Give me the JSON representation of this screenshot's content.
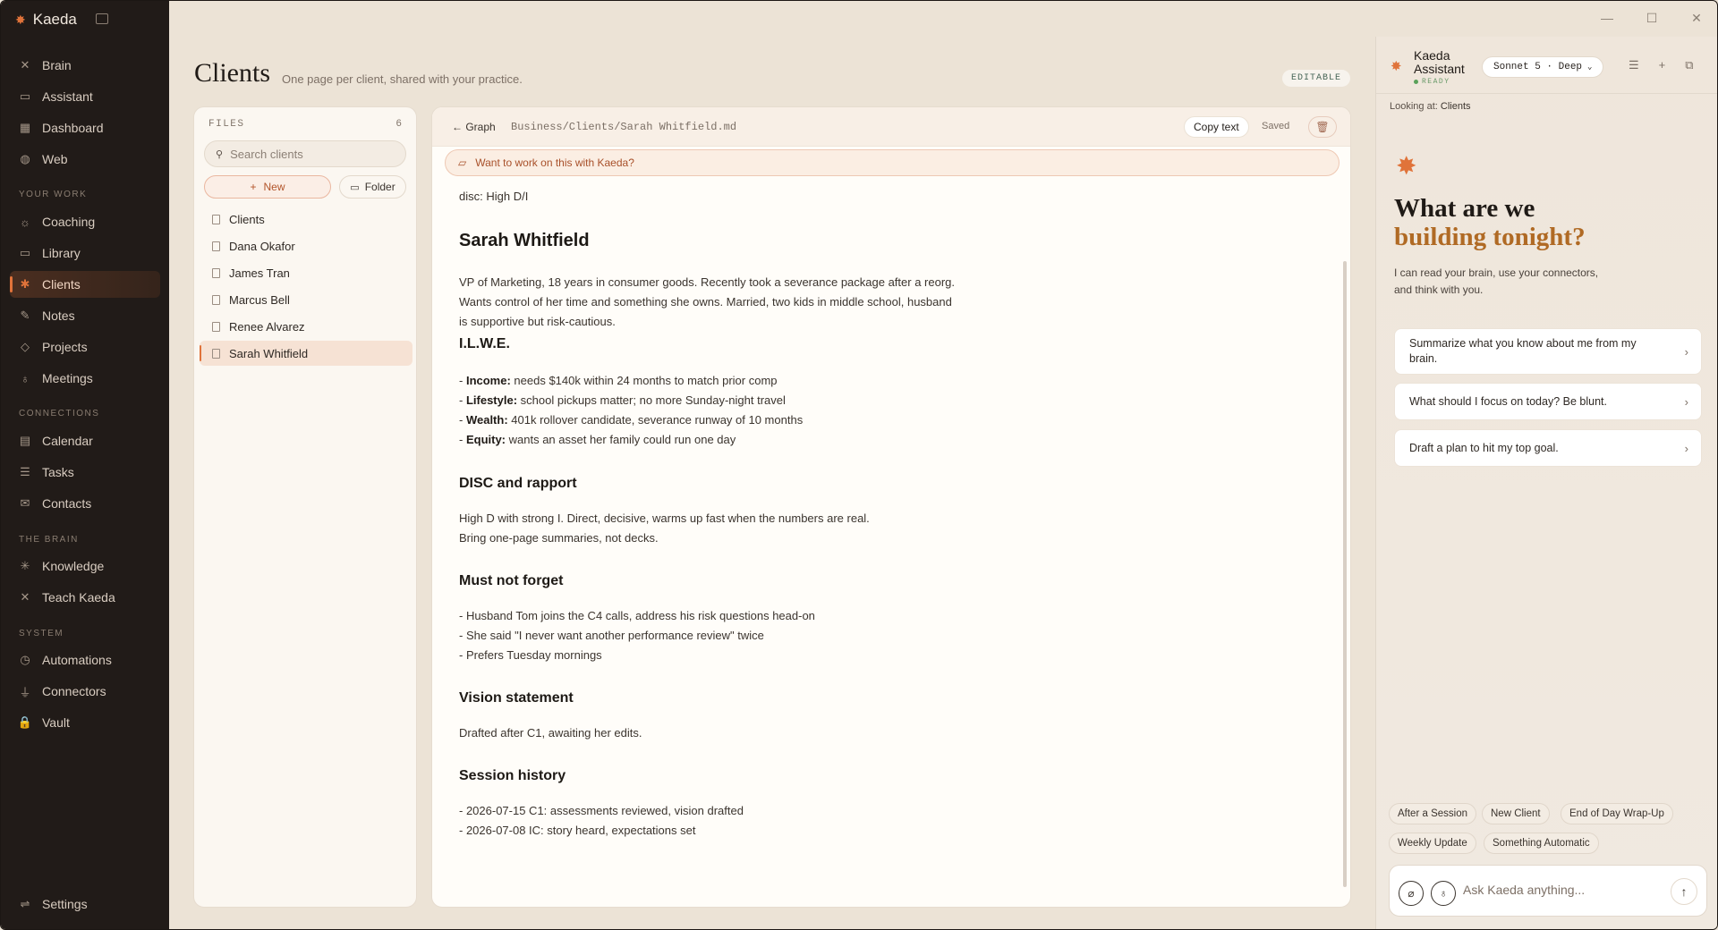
{
  "app": {
    "name": "Kaeda"
  },
  "sidebar": {
    "top_items": [
      {
        "label": "Brain",
        "icon": "✕"
      },
      {
        "label": "Assistant",
        "icon": "▭"
      },
      {
        "label": "Dashboard",
        "icon": "▦"
      },
      {
        "label": "Web",
        "icon": "◍"
      }
    ],
    "section_work": "YOUR WORK",
    "work_items": [
      {
        "label": "Coaching",
        "icon": "☼"
      },
      {
        "label": "Library",
        "icon": "▭"
      },
      {
        "label": "Clients",
        "icon": "✱"
      },
      {
        "label": "Notes",
        "icon": "✎"
      },
      {
        "label": "Projects",
        "icon": "◇"
      },
      {
        "label": "Meetings",
        "icon": "♁"
      }
    ],
    "section_connections": "CONNECTIONS",
    "connection_items": [
      {
        "label": "Calendar",
        "icon": "▤"
      },
      {
        "label": "Tasks",
        "icon": "☰"
      },
      {
        "label": "Contacts",
        "icon": "✉"
      }
    ],
    "section_brain": "THE BRAIN",
    "brain_items": [
      {
        "label": "Knowledge",
        "icon": "✳"
      },
      {
        "label": "Teach Kaeda",
        "icon": "✕"
      }
    ],
    "section_system": "SYSTEM",
    "system_items": [
      {
        "label": "Automations",
        "icon": "◷"
      },
      {
        "label": "Connectors",
        "icon": "⏚"
      },
      {
        "label": "Vault",
        "icon": "🔒"
      }
    ],
    "settings": {
      "label": "Settings",
      "icon": "⇌"
    }
  },
  "header": {
    "title": "Clients",
    "subtitle": "One page per client, shared with your practice.",
    "badge": "EDITABLE"
  },
  "files": {
    "header": "FILES",
    "count": "6",
    "search_placeholder": "Search clients",
    "new_label": "New",
    "folder_label": "Folder",
    "items": [
      "Clients",
      "Dana Okafor",
      "James Tran",
      "Marcus Bell",
      "Renee Alvarez",
      "Sarah Whitfield"
    ],
    "selected": "Sarah Whitfield"
  },
  "editor": {
    "graph_link": "← Graph",
    "path": "Business/Clients/Sarah Whitfield.md",
    "copy_label": "Copy text",
    "saved_label": "Saved",
    "banner": "Want to work on this with Kaeda?",
    "meta_line": "disc: High D/I",
    "title": "Sarah Whitfield",
    "intro": "VP of Marketing, 18 years in consumer goods. Recently took a severance package after a reorg. Wants control of her time and something she owns. Married, two kids in middle school, husband is supportive but risk-cautious.",
    "ilwe_heading": "I.L.W.E.",
    "ilwe": [
      {
        "key": "Income:",
        "text": " needs $140k within 24 months to match prior comp"
      },
      {
        "key": "Lifestyle:",
        "text": " school pickups matter; no more Sunday-night travel"
      },
      {
        "key": "Wealth:",
        "text": " 401k rollover candidate, severance runway of 10 months"
      },
      {
        "key": "Equity:",
        "text": " wants an asset her family could run one day"
      }
    ],
    "disc_heading": "DISC and rapport",
    "disc_line1": "High D with strong I. Direct, decisive, warms up fast when the numbers are real.",
    "disc_line2": "Bring one-page summaries, not decks.",
    "mnf_heading": "Must not forget",
    "mnf": [
      "- Husband Tom joins the C4 calls, address his risk questions head-on",
      "- She said \"I never want another performance review\" twice",
      "- Prefers Tuesday mornings"
    ],
    "vision_heading": "Vision statement",
    "vision_text": "Drafted after C1, awaiting her edits.",
    "history_heading": "Session history",
    "history": [
      "- 2026-07-15 C1: assessments reviewed, vision drafted",
      "- 2026-07-08 IC: story heard, expectations set"
    ]
  },
  "assistant": {
    "name": "Kaeda Assistant",
    "status": "READY",
    "model": "Sonnet 5 · Deep",
    "looking_label": "Looking at:",
    "looking_value": "Clients",
    "hero_line1": "What are we",
    "hero_line2": "building tonight?",
    "hero_sub": "I can read your brain, use your connectors, and think with you.",
    "suggestions": [
      "Summarize what you know about me from my brain.",
      "What should I focus on today? Be blunt.",
      "Draft a plan to hit my top goal."
    ],
    "chips": [
      "After a Session",
      "New Client",
      "End of Day Wrap-Up",
      "Weekly Update",
      "Something Automatic"
    ],
    "input_placeholder": "Ask Kaeda anything..."
  },
  "colors": {
    "accent": "#e0733a",
    "sidebar_bg": "#211b18",
    "page_bg": "#ece3d6"
  }
}
